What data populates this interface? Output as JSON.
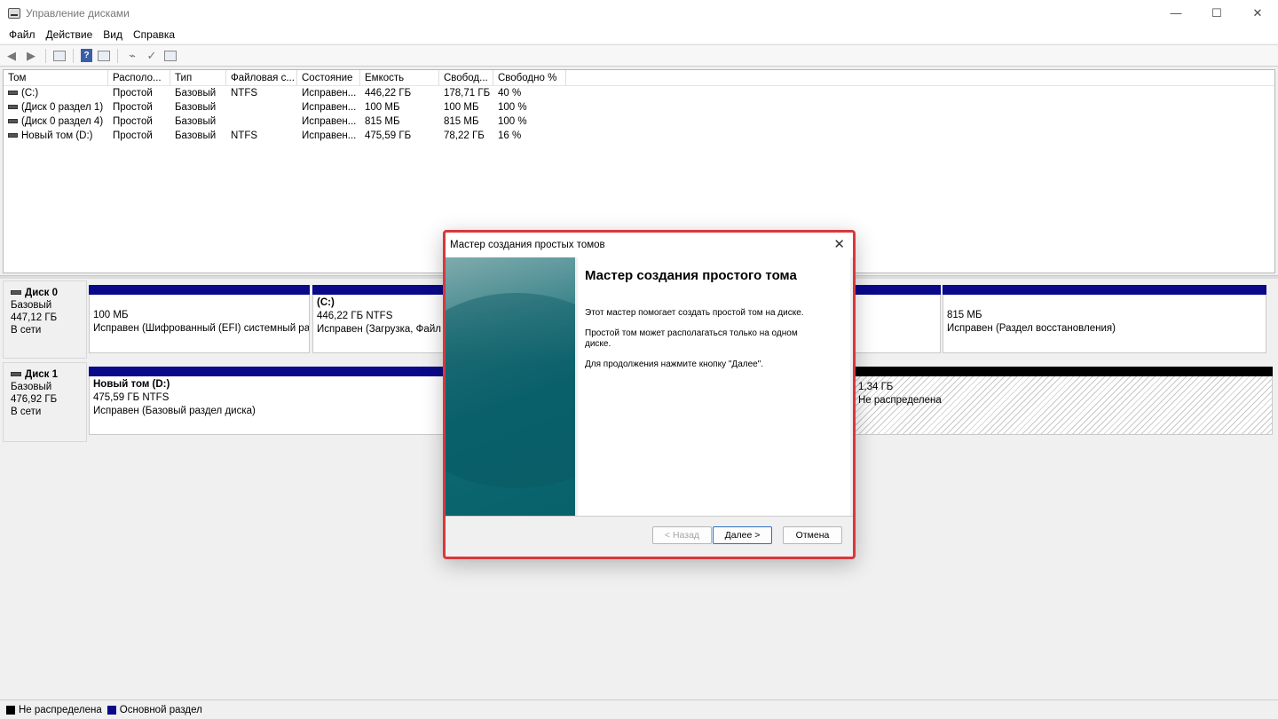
{
  "window": {
    "title": "Управление дисками",
    "minimize": "—",
    "maximize": "☐",
    "close": "✕"
  },
  "menu": [
    "Файл",
    "Действие",
    "Вид",
    "Справка"
  ],
  "volume_table": {
    "columns": [
      "Том",
      "Располо...",
      "Тип",
      "Файловая с...",
      "Состояние",
      "Емкость",
      "Свобод...",
      "Свободно %"
    ],
    "rows": [
      [
        "(C:)",
        "Простой",
        "Базовый",
        "NTFS",
        "Исправен...",
        "446,22 ГБ",
        "178,71 ГБ",
        "40 %"
      ],
      [
        "(Диск 0 раздел 1)",
        "Простой",
        "Базовый",
        "",
        "Исправен...",
        "100 МБ",
        "100 МБ",
        "100 %"
      ],
      [
        "(Диск 0 раздел 4)",
        "Простой",
        "Базовый",
        "",
        "Исправен...",
        "815 МБ",
        "815 МБ",
        "100 %"
      ],
      [
        "Новый том (D:)",
        "Простой",
        "Базовый",
        "NTFS",
        "Исправен...",
        "475,59 ГБ",
        "78,22 ГБ",
        "16 %"
      ]
    ]
  },
  "disks": [
    {
      "name": "Диск 0",
      "type": "Базовый",
      "size": "447,12 ГБ",
      "status": "В сети",
      "partitions": [
        {
          "title": "",
          "size": "100 МБ",
          "status": "Исправен (Шифрованный (EFI) системный раз"
        },
        {
          "title": "(C:)",
          "size": "446,22 ГБ NTFS",
          "status": "Исправен (Загрузка, Файл п"
        },
        {
          "title": "",
          "size": "815 МБ",
          "status": "Исправен (Раздел восстановления)"
        }
      ]
    },
    {
      "name": "Диск 1",
      "type": "Базовый",
      "size": "476,92 ГБ",
      "status": "В сети",
      "partitions": [
        {
          "title": "Новый том  (D:)",
          "size": "475,59 ГБ NTFS",
          "status": "Исправен (Базовый раздел диска)"
        },
        {
          "title": "",
          "size": "1,34 ГБ",
          "status": "Не распределена"
        }
      ]
    }
  ],
  "legend": [
    {
      "label": "Не распределена",
      "color": "#000000"
    },
    {
      "label": "Основной раздел",
      "color": "#09098a"
    }
  ],
  "wizard": {
    "title": "Мастер создания простых томов",
    "close": "✕",
    "heading": "Мастер создания простого тома",
    "paragraphs": [
      "Этот мастер помогает создать простой том на диске.",
      "Простой том может располагаться только на одном диске.",
      "Для продолжения нажмите кнопку \"Далее\"."
    ],
    "buttons": {
      "back": "< Назад",
      "next": "Далее >",
      "cancel": "Отмена"
    }
  }
}
